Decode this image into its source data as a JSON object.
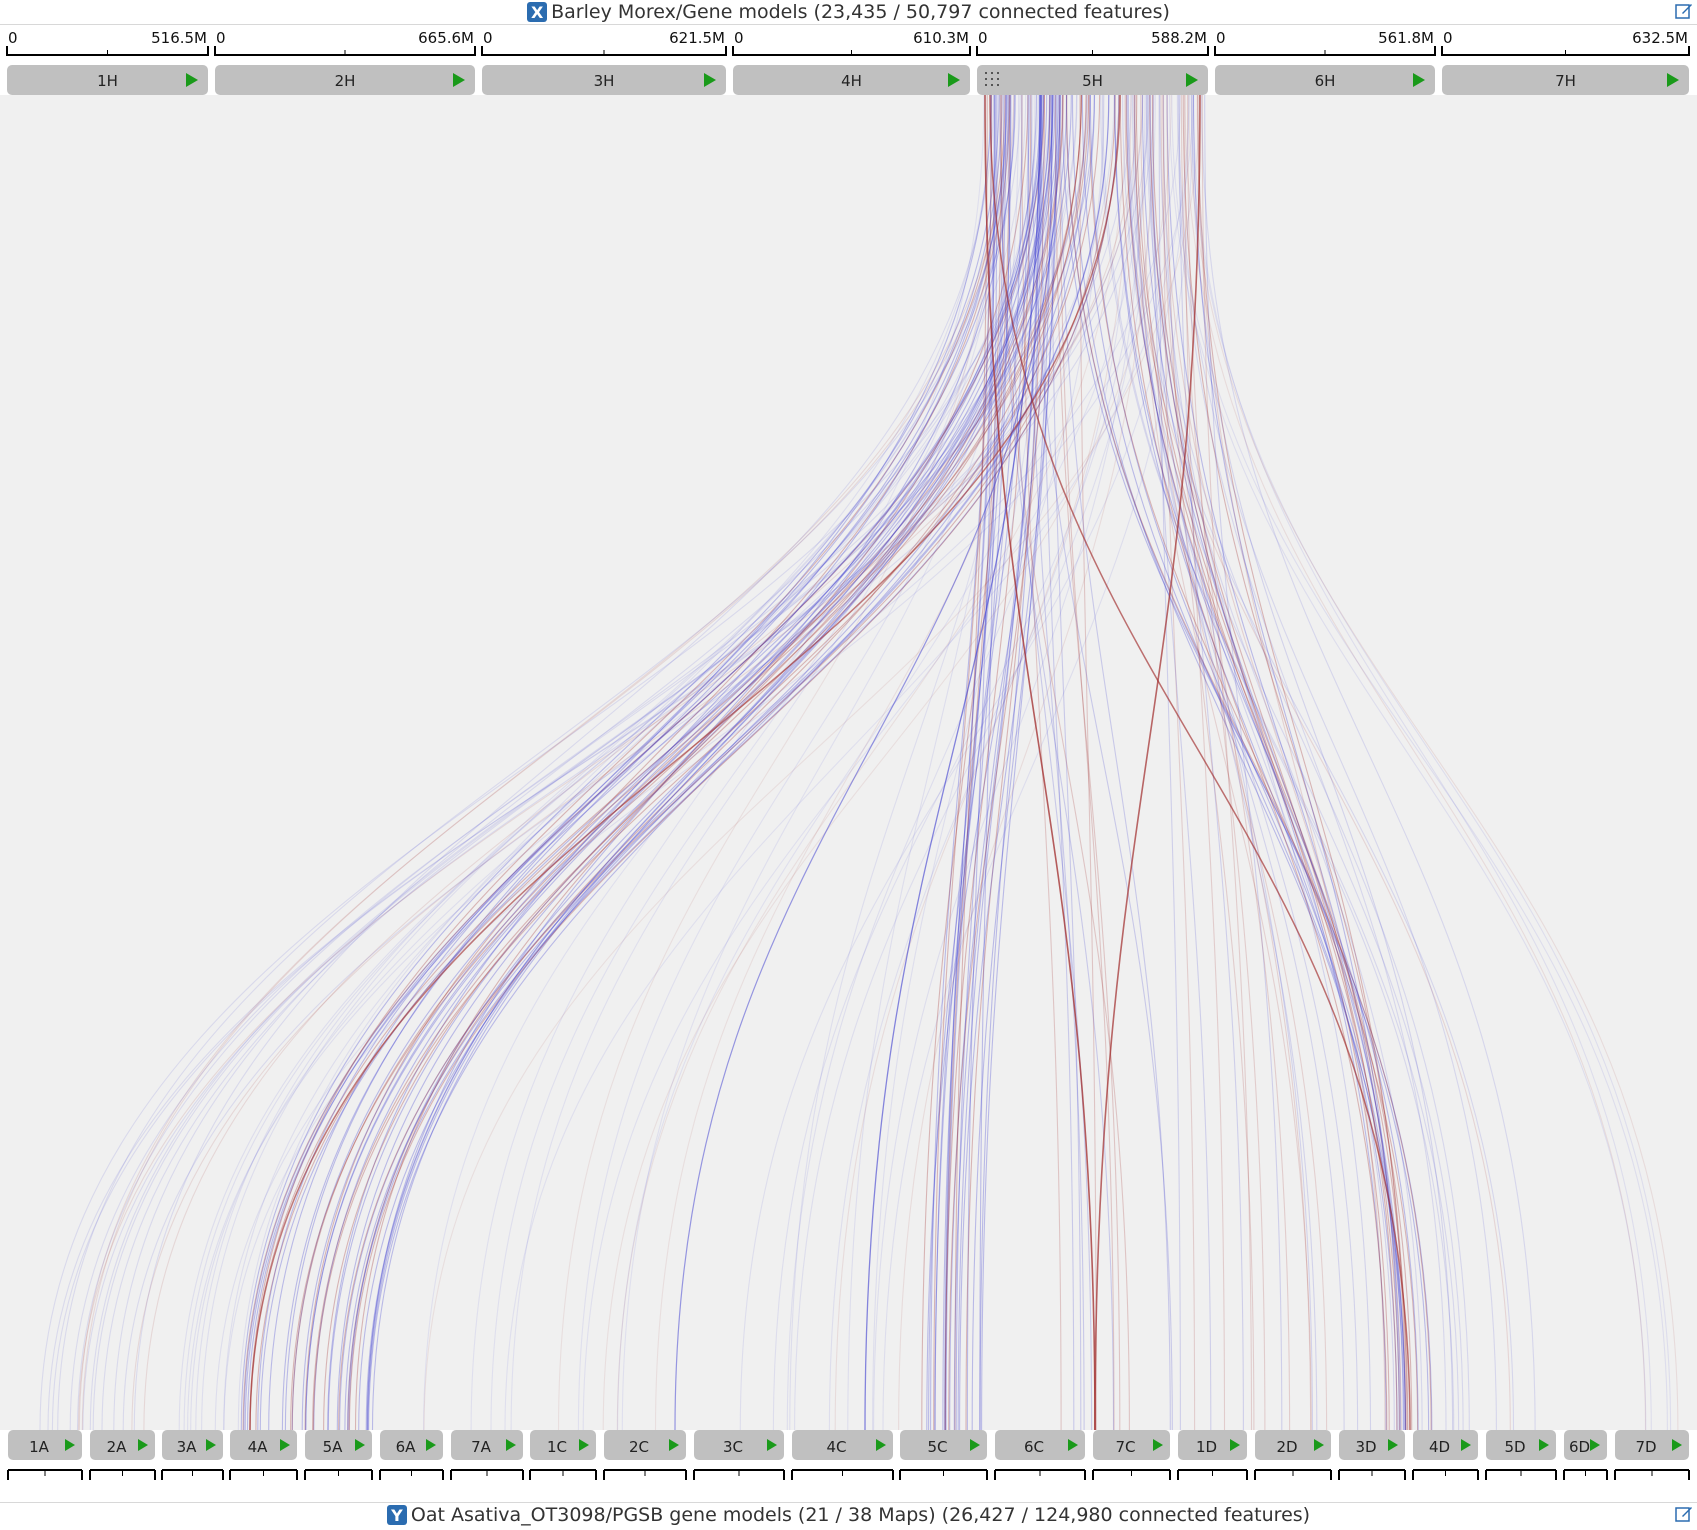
{
  "x_axis": {
    "badge": "X",
    "title": "Barley Morex/Gene models (23,435 / 50,797 connected features)",
    "chromosomes": [
      {
        "name": "1H",
        "min": "0",
        "max": "516.5M"
      },
      {
        "name": "2H",
        "min": "0",
        "max": "665.6M"
      },
      {
        "name": "3H",
        "min": "0",
        "max": "621.5M"
      },
      {
        "name": "4H",
        "min": "0",
        "max": "610.3M"
      },
      {
        "name": "5H",
        "min": "0",
        "max": "588.2M"
      },
      {
        "name": "6H",
        "min": "0",
        "max": "561.8M"
      },
      {
        "name": "7H",
        "min": "0",
        "max": "632.5M"
      }
    ]
  },
  "y_axis": {
    "badge": "Y",
    "title": "Oat Asativa_OT3098/PGSB gene models (21 / 38 Maps) (26,427 / 124,980 connected features)",
    "chromosomes": [
      "1A",
      "2A",
      "3A",
      "4A",
      "5A",
      "6A",
      "7A",
      "1C",
      "2C",
      "3C",
      "4C",
      "5C",
      "6C",
      "7C",
      "1D",
      "2D",
      "3D",
      "4D",
      "5D",
      "6D",
      "7D"
    ]
  },
  "colors": {
    "panel_bg": "#f0f0f0",
    "chr_button": "#c0c0c0",
    "play_arrow": "#1a9a1a",
    "link_blue": "#3a3acf",
    "link_red": "#a02a2a",
    "badge": "#2b6cb0"
  },
  "icons": {
    "x_badge": "axis-x-icon",
    "y_badge": "axis-y-icon",
    "edit": "edit-icon",
    "play": "play-arrow-icon",
    "drag": "drag-handle-icon"
  }
}
